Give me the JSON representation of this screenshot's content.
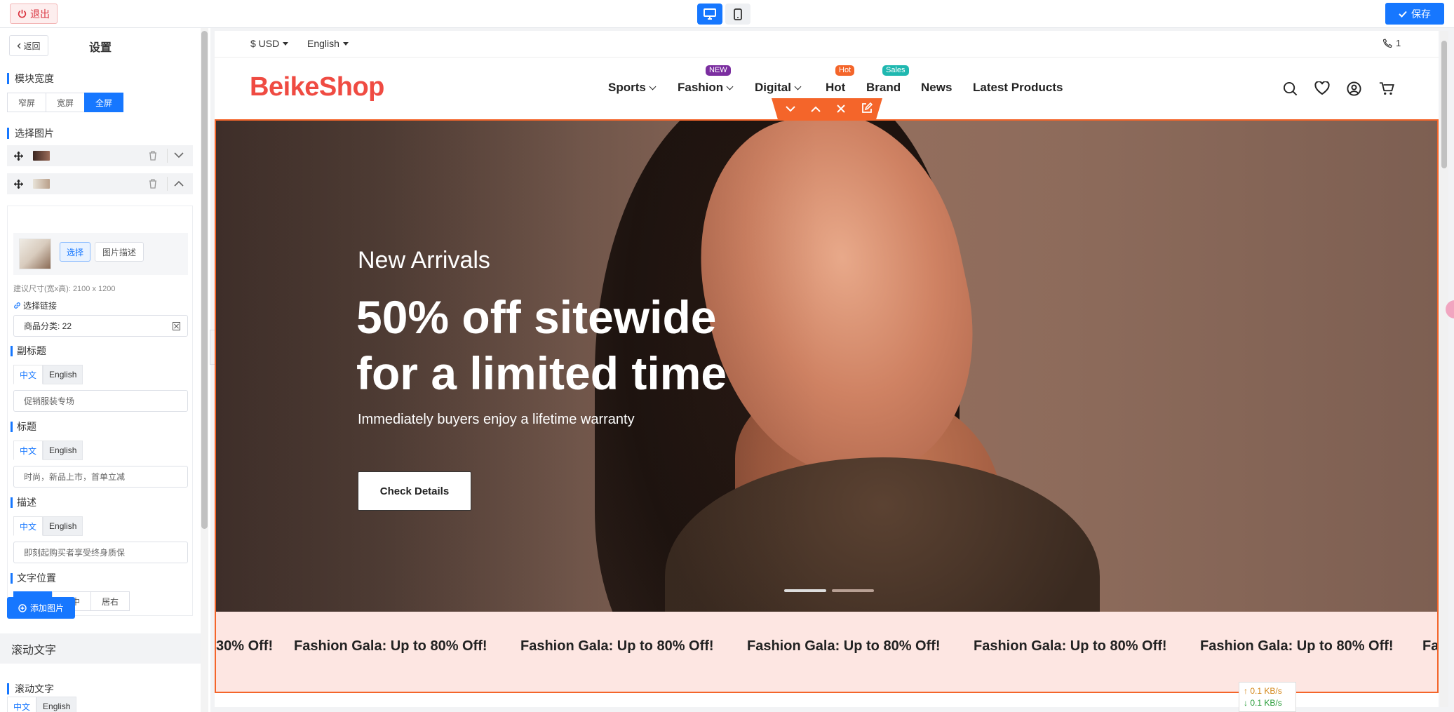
{
  "topbar": {
    "exit_label": "退出",
    "save_label": "保存",
    "device_desktop": "monitor-icon",
    "device_mobile": "mobile-icon"
  },
  "panel": {
    "back_label": "返回",
    "title": "设置",
    "width_section": "模块宽度",
    "width_options": [
      "窄屏",
      "宽屏",
      "全屏"
    ],
    "width_selected": "全屏",
    "images_section": "选择图片",
    "select_btn": "选择",
    "img_desc_btn": "图片描述",
    "size_hint": "建议尺寸(宽x高): 2100 x 1200",
    "link_label": "选择链接",
    "link_value": "商品分类: 22",
    "subtitle_label": "副标题",
    "subtitle_placeholder": "促销服装专场",
    "title_label": "标题",
    "title_placeholder": "时尚，新品上市，首单立减",
    "desc_label": "描述",
    "desc_placeholder": "即刻起购买者享受终身质保",
    "lang_tabs": [
      "中文",
      "English"
    ],
    "text_pos_label": "文字位置",
    "text_pos_options": [
      "居左",
      "居中",
      "居右"
    ],
    "text_pos_selected": "居左",
    "add_image": "添加图片",
    "scroll_section_head": "滚动文字",
    "scroll_text_label": "滚动文字"
  },
  "preview": {
    "currency": "$ USD",
    "language": "English",
    "phone": "1",
    "logo": "BeikeShop",
    "nav": [
      {
        "label": "Sports",
        "dropdown": true,
        "badge": ""
      },
      {
        "label": "Fashion",
        "dropdown": true,
        "badge": "NEW"
      },
      {
        "label": "Digital",
        "dropdown": true,
        "badge": ""
      },
      {
        "label": "Hot",
        "dropdown": false,
        "badge": "Hot"
      },
      {
        "label": "Brand",
        "dropdown": false,
        "badge": "Sales"
      },
      {
        "label": "News",
        "dropdown": false,
        "badge": ""
      },
      {
        "label": "Latest Products",
        "dropdown": false,
        "badge": ""
      }
    ],
    "badge_colors": {
      "NEW": "#7b2ea0",
      "Hot": "#f4652a",
      "Sales": "#1fb8b0"
    },
    "accent": "#f4652a",
    "hero": {
      "subtitle": "New Arrivals",
      "title_line1": "50% off sitewide",
      "title_line2": "for a limited time",
      "description": "Immediately buyers enjoy a lifetime warranty",
      "cta": "Check Details"
    },
    "marquee": {
      "text": "Fashion Gala: Up to 80% Off!",
      "partial_start": "30% Off!",
      "partial_end": "Fa"
    }
  },
  "netspeed": {
    "up": "↑ 0.1 KB/s",
    "down": "↓ 0.1 KB/s"
  }
}
